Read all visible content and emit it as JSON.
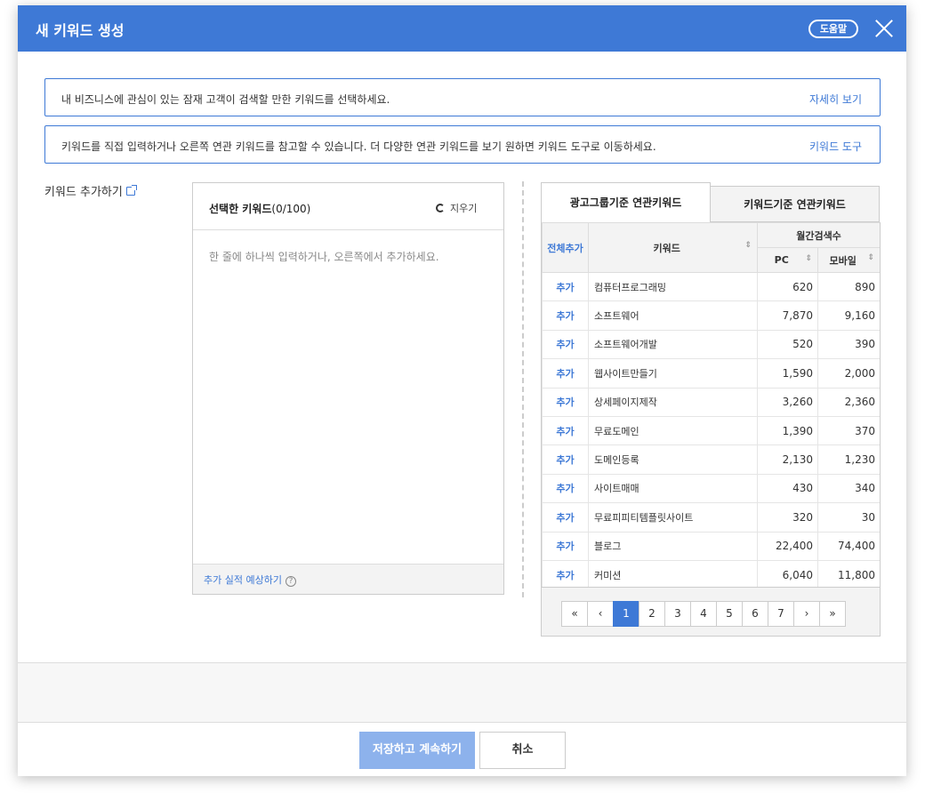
{
  "header": {
    "title": "새 키워드 생성",
    "help_label": "도움말"
  },
  "info": [
    {
      "text": "내 비즈니스에 관심이 있는 잠재 고객이 검색할 만한 키워드를 선택하세요.",
      "link": "자세히 보기"
    },
    {
      "text": "키워드를 직접 입력하거나 오른쪽 연관 키워드를 참고할 수 있습니다. 더 다양한 연관 키워드를 보기 원하면 키워드 도구로 이동하세요.",
      "link": "키워드 도구"
    }
  ],
  "add_label": "키워드 추가하기",
  "left_panel": {
    "title": "선택한 키워드",
    "count": "(0/100)",
    "clear_label": "지우기",
    "placeholder": "한 줄에 하나씩 입력하거나, 오른쪽에서 추가하세요.",
    "predict_label": "추가 실적 예상하기"
  },
  "right_panel": {
    "tabs": [
      "광고그룹기준 연관키워드",
      "키워드기준 연관키워드"
    ],
    "headers": {
      "add_all": "전체추가",
      "keyword": "키워드",
      "monthly": "월간검색수",
      "pc": "PC",
      "mobile": "모바일"
    },
    "rows": [
      {
        "add": "추가",
        "keyword": "컴퓨터프로그래밍",
        "pc": "620",
        "mobile": "890"
      },
      {
        "add": "추가",
        "keyword": "소프트웨어",
        "pc": "7,870",
        "mobile": "9,160"
      },
      {
        "add": "추가",
        "keyword": "소프트웨어개발",
        "pc": "520",
        "mobile": "390"
      },
      {
        "add": "추가",
        "keyword": "웹사이트만들기",
        "pc": "1,590",
        "mobile": "2,000"
      },
      {
        "add": "추가",
        "keyword": "상세페이지제작",
        "pc": "3,260",
        "mobile": "2,360"
      },
      {
        "add": "추가",
        "keyword": "무료도메인",
        "pc": "1,390",
        "mobile": "370"
      },
      {
        "add": "추가",
        "keyword": "도메인등록",
        "pc": "2,130",
        "mobile": "1,230"
      },
      {
        "add": "추가",
        "keyword": "사이트매매",
        "pc": "430",
        "mobile": "340"
      },
      {
        "add": "추가",
        "keyword": "무료피피티템플릿사이트",
        "pc": "320",
        "mobile": "30"
      },
      {
        "add": "추가",
        "keyword": "블로그",
        "pc": "22,400",
        "mobile": "74,400"
      },
      {
        "add": "추가",
        "keyword": "커미션",
        "pc": "6,040",
        "mobile": "11,800"
      }
    ],
    "pager": {
      "first": "«",
      "prev": "‹",
      "pages": [
        "1",
        "2",
        "3",
        "4",
        "5",
        "6",
        "7"
      ],
      "next": "›",
      "last": "»",
      "current": "1"
    }
  },
  "footer": {
    "save_label": "저장하고 계속하기",
    "cancel_label": "취소"
  },
  "colors": {
    "primary": "#3e79d6",
    "save_disabled": "#8db2ec"
  }
}
